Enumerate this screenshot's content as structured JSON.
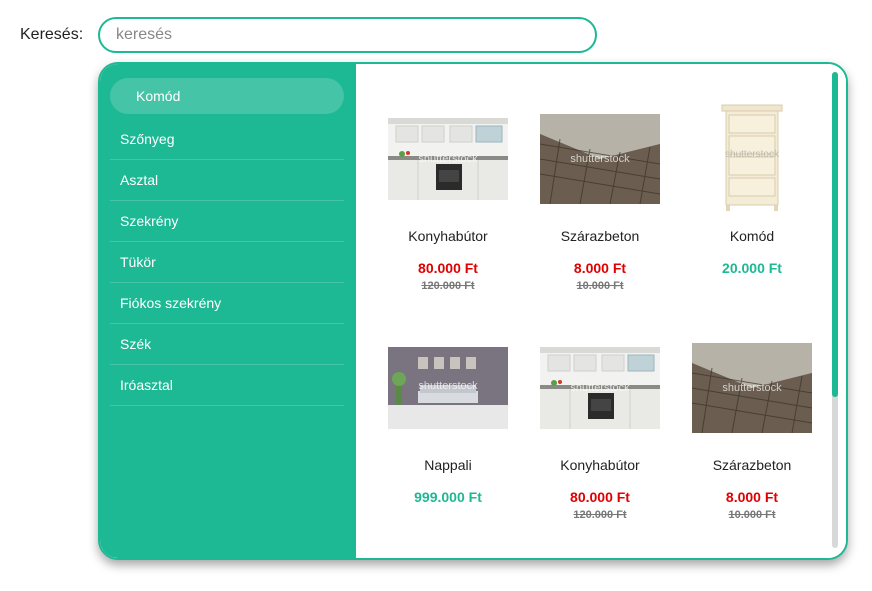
{
  "search": {
    "label": "Keresés:",
    "placeholder": "keresés",
    "value": ""
  },
  "colors": {
    "accent": "#1db894",
    "sale": "#e00000"
  },
  "categories": [
    {
      "label": "Komód",
      "active": true
    },
    {
      "label": "Szőnyeg"
    },
    {
      "label": "Asztal"
    },
    {
      "label": "Szekrény"
    },
    {
      "label": "Tükör"
    },
    {
      "label": "Fiókos szekrény"
    },
    {
      "label": "Szék"
    },
    {
      "label": "Iróasztal"
    }
  ],
  "products": [
    {
      "name": "Konyhabútor",
      "price": "80.000 Ft",
      "old_price": "120.000 Ft",
      "image": "kitchen-image"
    },
    {
      "name": "Szárazbeton",
      "price": "8.000 Ft",
      "old_price": "10.000 Ft",
      "image": "concrete-image"
    },
    {
      "name": "Komód",
      "price": "20.000 Ft",
      "old_price": "",
      "image": "dresser-image"
    },
    {
      "name": "Nappali",
      "price": "999.000 Ft",
      "old_price": "",
      "image": "living-room-image"
    },
    {
      "name": "Konyhabútor",
      "price": "80.000 Ft",
      "old_price": "120.000 Ft",
      "image": "kitchen-image"
    },
    {
      "name": "Szárazbeton",
      "price": "8.000 Ft",
      "old_price": "10.000 Ft",
      "image": "concrete-image"
    }
  ],
  "watermark": "shutterstock"
}
